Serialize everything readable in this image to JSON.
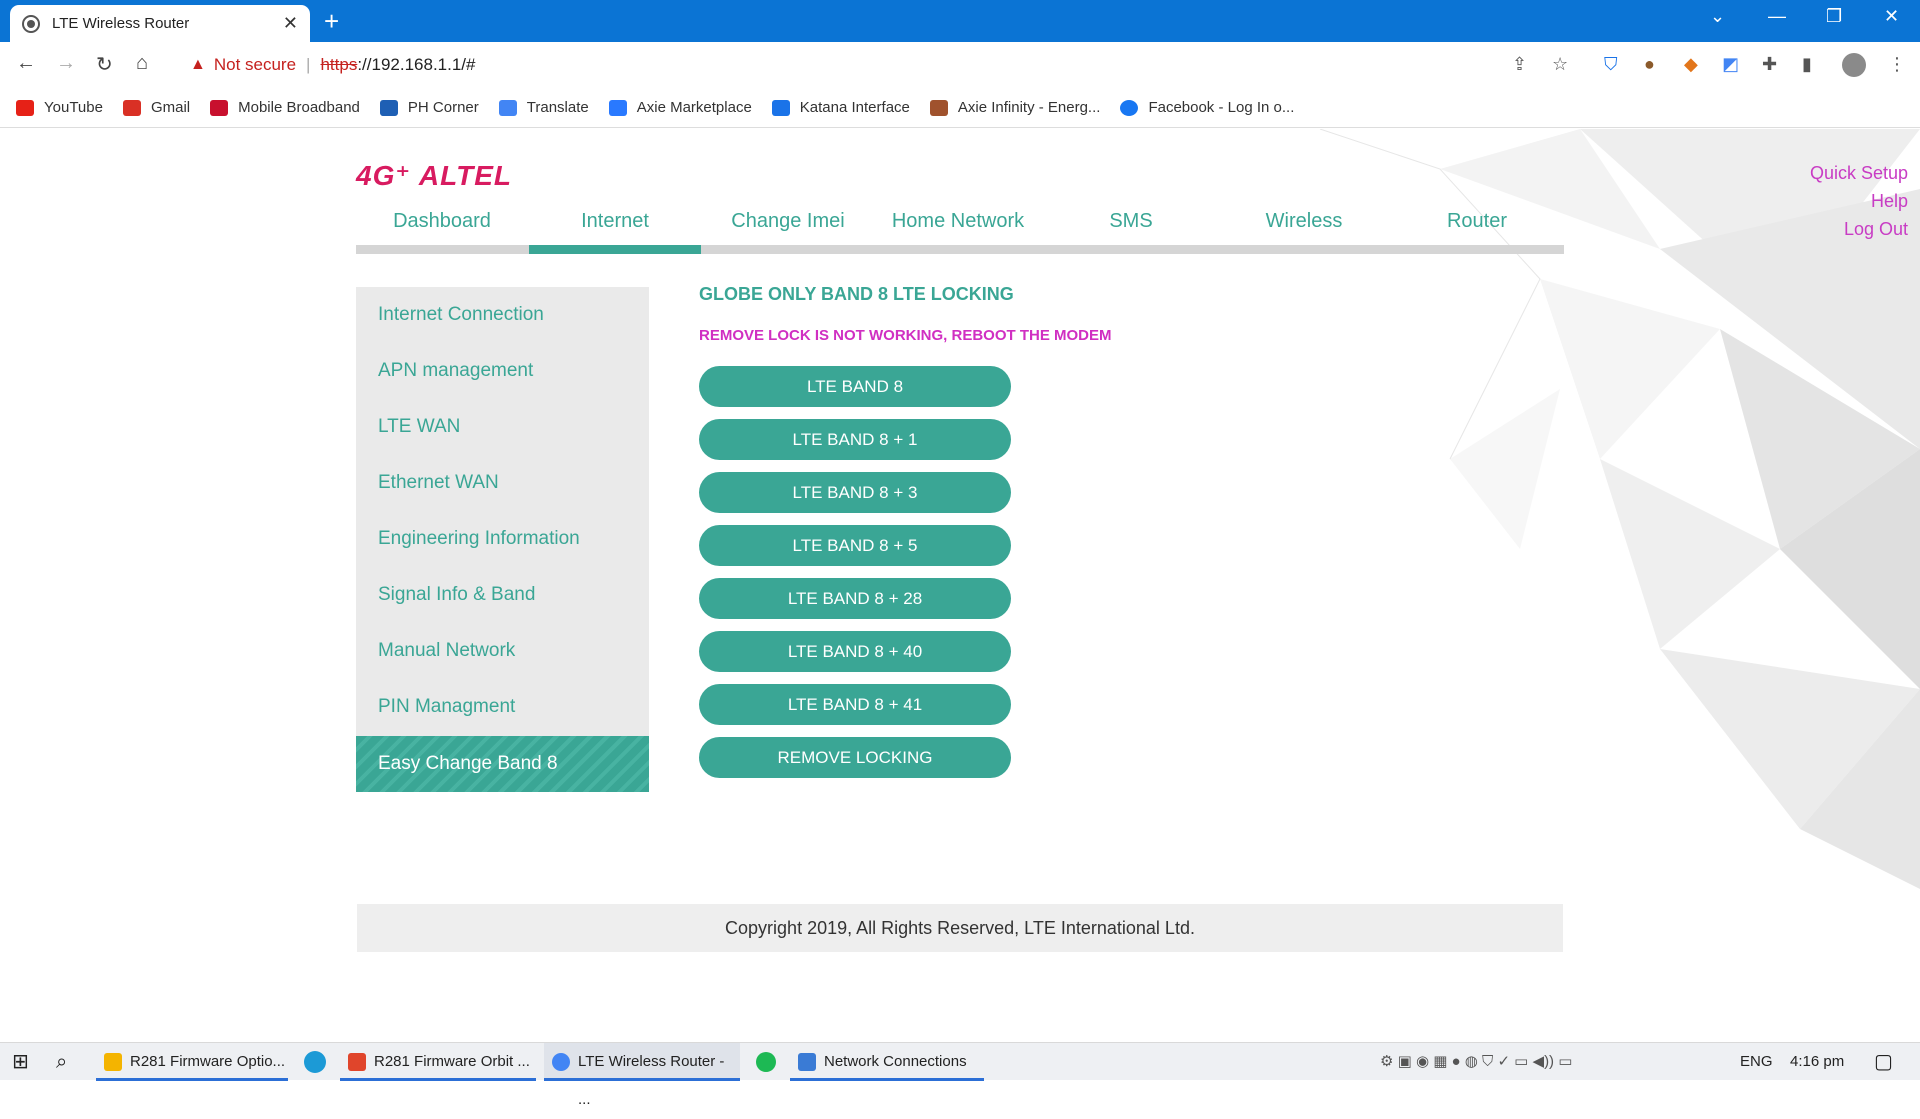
{
  "browser": {
    "tab_title": "LTE Wireless Router",
    "url_security": "Not secure",
    "url_protocol": "https",
    "url_rest": "://192.168.1.1/#",
    "bookmarks": [
      {
        "label": "YouTube",
        "color": "#e62117"
      },
      {
        "label": "Gmail",
        "color": "#d93025"
      },
      {
        "label": "Mobile Broadband",
        "color": "#c8102e"
      },
      {
        "label": "PH Corner",
        "color": "#1e5fb4"
      },
      {
        "label": "Translate",
        "color": "#4285f4"
      },
      {
        "label": "Axie Marketplace",
        "color": "#2979ff"
      },
      {
        "label": "Katana Interface",
        "color": "#1a73e8"
      },
      {
        "label": "Axie Infinity - Energ...",
        "color": "#a0522d"
      },
      {
        "label": "Facebook - Log In o...",
        "color": "#1877f2"
      }
    ]
  },
  "header": {
    "logo": "4G⁺ ALTEL",
    "quick_setup": "Quick Setup",
    "help": "Help",
    "logout": "Log Out"
  },
  "mainnav": [
    "Dashboard",
    "Internet",
    "Change Imei",
    "Home Network",
    "SMS",
    "Wireless",
    "Router"
  ],
  "mainnav_active": "Internet",
  "sidebar": [
    "Internet Connection",
    "APN management",
    "LTE WAN",
    "Ethernet WAN",
    "Engineering Information",
    "Signal Info & Band",
    "Manual Network",
    "PIN Managment",
    "Easy Change Band 8"
  ],
  "content": {
    "heading": "GLOBE ONLY BAND 8 LTE LOCKING",
    "note": "REMOVE LOCK IS NOT WORKING, REBOOT THE MODEM",
    "buttons": [
      "LTE BAND 8",
      "LTE BAND 8 + 1",
      "LTE BAND 8 + 3",
      "LTE BAND 8 + 5",
      "LTE BAND 8 + 28",
      "LTE BAND 8 + 40",
      "LTE BAND 8 + 41",
      "REMOVE LOCKING"
    ]
  },
  "footer": "Copyright 2019, All Rights Reserved, LTE International Ltd.",
  "taskbar": {
    "items": [
      "R281 Firmware Optio...",
      "R281 Firmware Orbit ...",
      "LTE Wireless Router - ...",
      "Network Connections"
    ],
    "lang": "ENG",
    "time": "4:16 pm"
  },
  "colors": {
    "accent": "#3aa695",
    "magenta": "#d02fc2",
    "brand": "#d81b60",
    "titlebar": "#0b74d4"
  }
}
